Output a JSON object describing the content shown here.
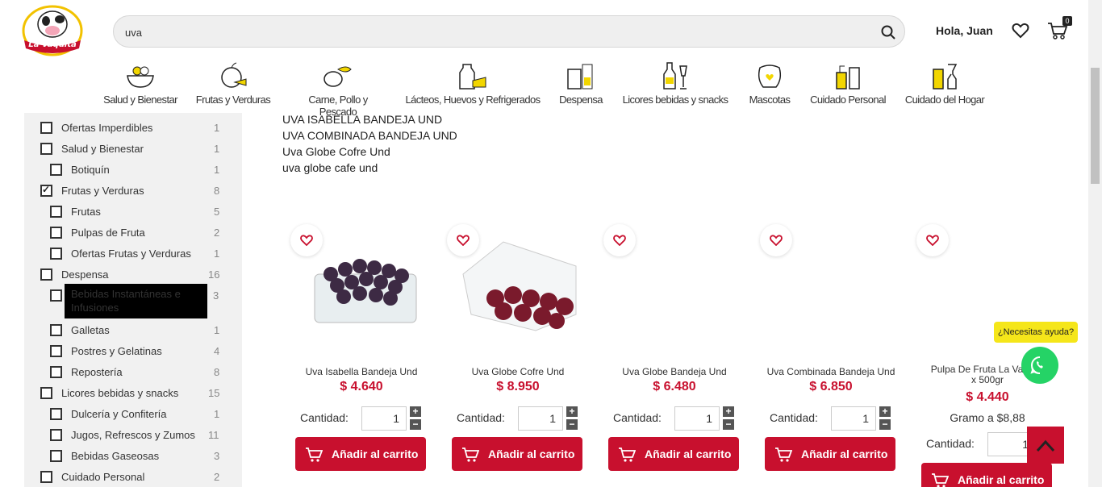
{
  "header": {
    "logo_text": "La Vaquita",
    "search_value": "uva",
    "greeting": "Hola, Juan",
    "cart_count": "0"
  },
  "categories": [
    {
      "label": "Salud y Bienestar",
      "icon": "salad-bowl-icon"
    },
    {
      "label": "Frutas y Verduras",
      "icon": "apple-carrot-icon"
    },
    {
      "label": "Carne, Pollo y Pescado",
      "icon": "meat-fish-icon"
    },
    {
      "label": "Lácteos, Huevos y Refrigerados",
      "icon": "milk-cheese-icon"
    },
    {
      "label": "Despensa",
      "icon": "pantry-icon"
    },
    {
      "label": "Licores bebidas y snacks",
      "icon": "bottles-icon"
    },
    {
      "label": "Mascotas",
      "icon": "pet-icon"
    },
    {
      "label": "Cuidado Personal",
      "icon": "personal-care-icon"
    },
    {
      "label": "Cuidado del Hogar",
      "icon": "cleaning-icon"
    }
  ],
  "filters": [
    {
      "label": "Ofertas Imperdibles",
      "count": "1",
      "checked": false
    },
    {
      "label": "Salud y Bienestar",
      "count": "1",
      "checked": false
    },
    {
      "label": "Botiquín",
      "count": "1",
      "checked": false
    },
    {
      "label": "Frutas y Verduras",
      "count": "8",
      "checked": true
    },
    {
      "label": "Frutas",
      "count": "5",
      "checked": false
    },
    {
      "label": "Pulpas de Fruta",
      "count": "2",
      "checked": false
    },
    {
      "label": "Ofertas Frutas y Verduras",
      "count": "1",
      "checked": false
    },
    {
      "label": "Despensa",
      "count": "16",
      "checked": false
    },
    {
      "label": "Bebidas Instantáneas e Infusiones",
      "count": "3",
      "checked": false
    },
    {
      "label": "Galletas",
      "count": "1",
      "checked": false
    },
    {
      "label": "Postres y Gelatinas",
      "count": "4",
      "checked": false
    },
    {
      "label": "Repostería",
      "count": "8",
      "checked": false
    },
    {
      "label": "Licores bebidas y snacks",
      "count": "15",
      "checked": false
    },
    {
      "label": "Dulcería y Confitería",
      "count": "1",
      "checked": false
    },
    {
      "label": "Jugos, Refrescos y Zumos",
      "count": "11",
      "checked": false
    },
    {
      "label": "Bebidas Gaseosas",
      "count": "3",
      "checked": false
    },
    {
      "label": "Cuidado Personal",
      "count": "2",
      "checked": false
    }
  ],
  "suggestions": [
    "UVA ISABELLA BANDEJA UND",
    "UVA COMBINADA BANDEJA UND",
    "Uva Globe Cofre Und",
    "uva globe cafe und"
  ],
  "products": [
    {
      "name": "Uva Isabella Bandeja Und",
      "price": "$ 4.640",
      "qty_label": "Cantidad:",
      "qty": "1",
      "add_label": "Añadir al carrito"
    },
    {
      "name": "Uva Globe Cofre Und",
      "price": "$ 8.950",
      "qty_label": "Cantidad:",
      "qty": "1",
      "add_label": "Añadir al carrito"
    },
    {
      "name": "Uva Globe Bandeja Und",
      "price": "$ 6.480",
      "qty_label": "Cantidad:",
      "qty": "1",
      "add_label": "Añadir al carrito"
    },
    {
      "name": "Uva Combinada Bandeja Und",
      "price": "$ 6.850",
      "qty_label": "Cantidad:",
      "qty": "1",
      "add_label": "Añadir al carrito"
    },
    {
      "name_line1": "Pulpa De Fruta La Vaquita",
      "name_line2": "x 500gr",
      "price": "$ 4.440",
      "unit_price": "Gramo a $8,88",
      "qty_label": "Cantidad:",
      "qty": "1",
      "add_label": "Añadir al carrito"
    }
  ],
  "floating": {
    "help_text": "¿Necesitas ayuda?"
  },
  "colors": {
    "brand_red": "#c8102e",
    "whatsapp_green": "#25d366",
    "help_yellow": "#f5e61a"
  }
}
